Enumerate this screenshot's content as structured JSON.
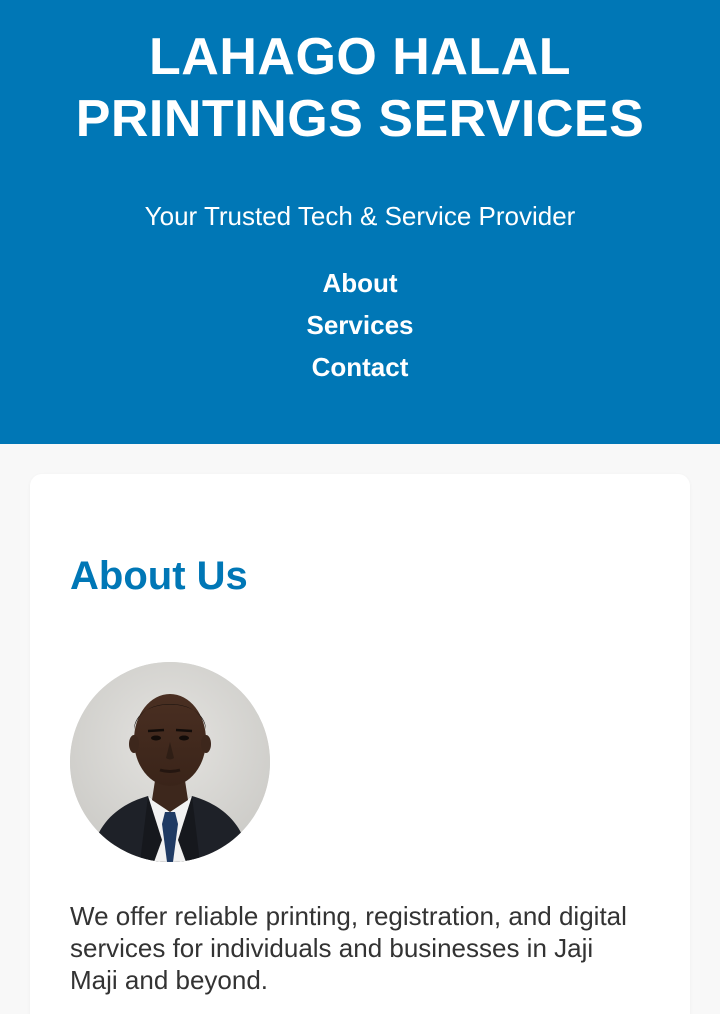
{
  "header": {
    "title_line1": "LAHAGO HALAL",
    "title_line2": "PRINTINGS SERVICES",
    "tagline": "Your Trusted Tech & Service Provider",
    "nav": [
      {
        "label": "About"
      },
      {
        "label": "Services"
      },
      {
        "label": "Contact"
      }
    ]
  },
  "about": {
    "title": "About Us",
    "avatar_icon": "person-portrait",
    "text": "We offer reliable printing, registration, and digital services for individuals and businesses in Jaji Maji and beyond."
  },
  "colors": {
    "primary": "#0077b6",
    "background": "#f8f8f8",
    "card": "#ffffff",
    "text": "#333333"
  }
}
